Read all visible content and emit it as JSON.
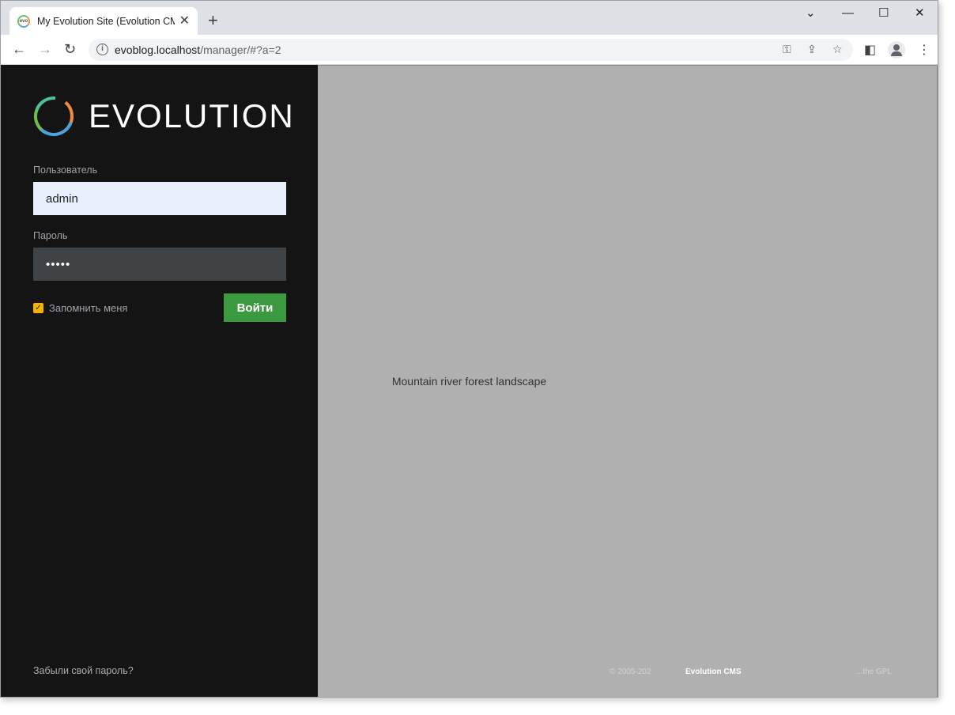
{
  "browser": {
    "tab_title": "My Evolution Site (Evolution CMS",
    "favicon_text": "evo",
    "tab_close": "✕",
    "new_tab": "+",
    "url_host": "evoblog.localhost",
    "url_path": "/manager/#?a=2",
    "icons": [
      "back-icon",
      "forward-icon",
      "reload-icon",
      "site-info-icon",
      "key-icon",
      "share-icon",
      "star-icon",
      "side-panel-icon",
      "profile-icon",
      "menu-icon"
    ]
  },
  "window_controls": {
    "dropdown": "⌄",
    "minimize": "—",
    "maximize": "☐",
    "close": "✕"
  },
  "logo": {
    "text": "EVOLUTION"
  },
  "login": {
    "username_label": "Пользователь",
    "username_value": "admin",
    "password_label": "Пароль",
    "password_value": "•••••",
    "remember_label": "Запомнить меня",
    "remember_checked": true,
    "login_button": "Войти",
    "forgot_link": "Забыли свой пароль?"
  },
  "footer": {
    "copyright": "© 2005-202",
    "brand": "Evolution CMS",
    "right_text": "...the GPL"
  },
  "background": {
    "label": "Mountain river forest landscape"
  },
  "colors": {
    "accent_green": "#3b9a3f",
    "checkbox_yellow": "#f5b300",
    "panel": "#141414"
  }
}
